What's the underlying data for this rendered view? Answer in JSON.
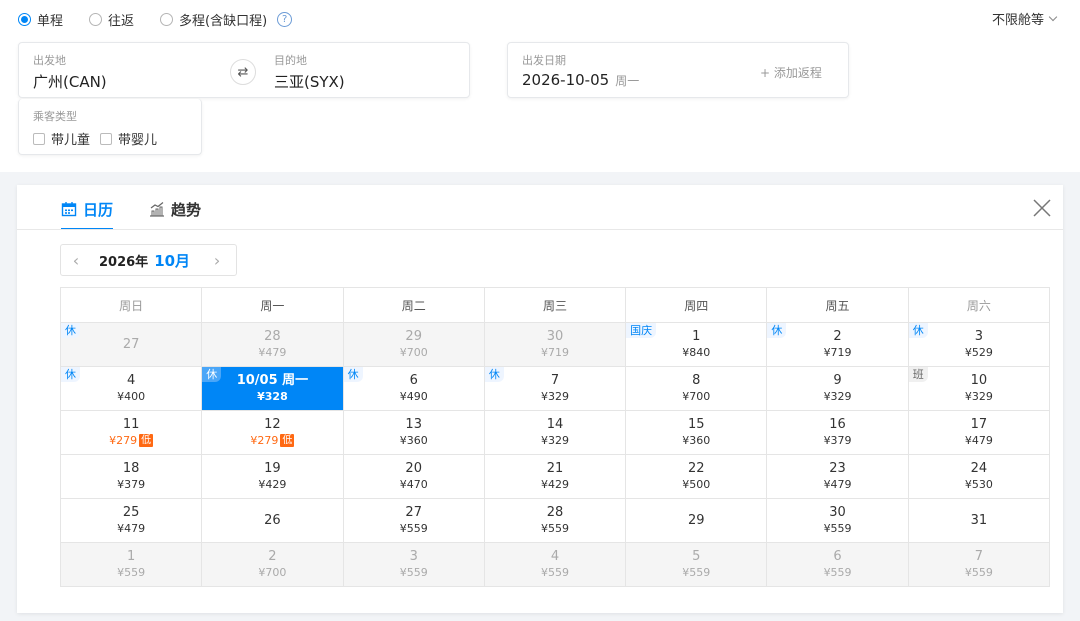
{
  "trip_types": [
    {
      "label": "单程",
      "checked": true
    },
    {
      "label": "往返",
      "checked": false
    },
    {
      "label": "多程(含缺口程)",
      "checked": false
    }
  ],
  "help_icon": "question-circle-icon",
  "cabin": {
    "label": "不限舱等"
  },
  "route": {
    "from_label": "出发地",
    "from_value": "广州(CAN)",
    "to_label": "目的地",
    "to_value": "三亚(SYX)",
    "swap_icon": "swap-arrows-icon"
  },
  "date": {
    "label": "出发日期",
    "value": "2026-10-05",
    "weekday": "周一",
    "add_return": "+ 添加返程"
  },
  "passenger": {
    "label": "乘客类型",
    "options": [
      {
        "label": "带儿童",
        "checked": false
      },
      {
        "label": "带婴儿",
        "checked": false
      }
    ]
  },
  "tabs": [
    {
      "label": "日历",
      "icon": "calendar-icon",
      "active": true
    },
    {
      "label": "趋势",
      "icon": "trend-chart-icon",
      "active": false
    }
  ],
  "close_icon": "close-icon",
  "month_nav": {
    "prev": "‹",
    "year": "2026年",
    "month": "10月",
    "next": "›"
  },
  "weekdays": [
    {
      "label": "周日",
      "weekend": true
    },
    {
      "label": "周一",
      "weekend": false
    },
    {
      "label": "周二",
      "weekend": false
    },
    {
      "label": "周三",
      "weekend": false
    },
    {
      "label": "周四",
      "weekend": false
    },
    {
      "label": "周五",
      "weekend": false
    },
    {
      "label": "周六",
      "weekend": true
    }
  ],
  "days": [
    {
      "day": "27",
      "price": "",
      "other": true,
      "tag": "休"
    },
    {
      "day": "28",
      "price": "¥479",
      "other": true
    },
    {
      "day": "29",
      "price": "¥700",
      "other": true
    },
    {
      "day": "30",
      "price": "¥719",
      "other": true
    },
    {
      "day": "1",
      "price": "¥840",
      "tag": "国庆"
    },
    {
      "day": "2",
      "price": "¥719",
      "tag": "休"
    },
    {
      "day": "3",
      "price": "¥529",
      "tag": "休"
    },
    {
      "day": "4",
      "price": "¥400",
      "tag": "休"
    },
    {
      "day": "10/05 周一",
      "price": "¥328",
      "tag": "休",
      "selected": true
    },
    {
      "day": "6",
      "price": "¥490",
      "tag": "休"
    },
    {
      "day": "7",
      "price": "¥329",
      "tag": "休"
    },
    {
      "day": "8",
      "price": "¥700"
    },
    {
      "day": "9",
      "price": "¥329"
    },
    {
      "day": "10",
      "price": "¥329",
      "tag": "班",
      "work": true
    },
    {
      "day": "11",
      "price": "¥279",
      "low": true,
      "low_label": "低"
    },
    {
      "day": "12",
      "price": "¥279",
      "low": true,
      "low_label": "低"
    },
    {
      "day": "13",
      "price": "¥360"
    },
    {
      "day": "14",
      "price": "¥329"
    },
    {
      "day": "15",
      "price": "¥360"
    },
    {
      "day": "16",
      "price": "¥379"
    },
    {
      "day": "17",
      "price": "¥479"
    },
    {
      "day": "18",
      "price": "¥379"
    },
    {
      "day": "19",
      "price": "¥429"
    },
    {
      "day": "20",
      "price": "¥470"
    },
    {
      "day": "21",
      "price": "¥429"
    },
    {
      "day": "22",
      "price": "¥500"
    },
    {
      "day": "23",
      "price": "¥479"
    },
    {
      "day": "24",
      "price": "¥530"
    },
    {
      "day": "25",
      "price": "¥479"
    },
    {
      "day": "26",
      "price": ""
    },
    {
      "day": "27",
      "price": "¥559"
    },
    {
      "day": "28",
      "price": "¥559"
    },
    {
      "day": "29",
      "price": ""
    },
    {
      "day": "30",
      "price": "¥559"
    },
    {
      "day": "31",
      "price": ""
    },
    {
      "day": "1",
      "price": "¥559",
      "other": true
    },
    {
      "day": "2",
      "price": "¥700",
      "other": true
    },
    {
      "day": "3",
      "price": "¥559",
      "other": true
    },
    {
      "day": "4",
      "price": "¥559",
      "other": true
    },
    {
      "day": "5",
      "price": "¥559",
      "other": true
    },
    {
      "day": "6",
      "price": "¥559",
      "other": true
    },
    {
      "day": "7",
      "price": "¥559",
      "other": true
    }
  ],
  "colors": {
    "accent": "#0086f6",
    "low_price": "#ff6913"
  }
}
